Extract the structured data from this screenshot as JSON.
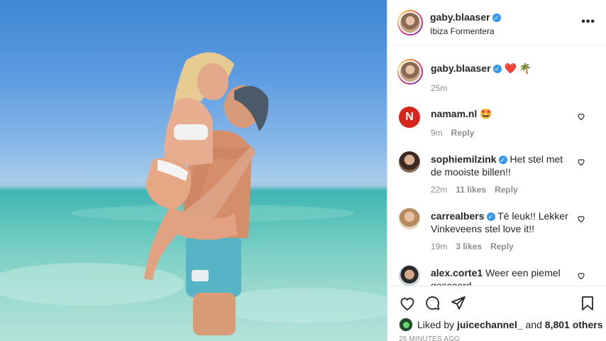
{
  "post": {
    "author": "gaby.blaaser",
    "location": "Ibiza Formentera",
    "more_label": "•••"
  },
  "caption": {
    "username": "gaby.blaaser",
    "text": "❤️ 🌴",
    "time": "25m"
  },
  "comments": [
    {
      "username": "namam.nl",
      "text": "🤩",
      "time": "9m",
      "likes": "",
      "reply": "Reply",
      "avatar_letter": "N"
    },
    {
      "username": "sophiemilzink",
      "text": "Het stel met de mooiste billen!!",
      "time": "22m",
      "likes": "11 likes",
      "reply": "Reply"
    },
    {
      "username": "carrealbers",
      "text": "Té leuk!! Lekker Vinkeveens stel love it!!",
      "time": "19m",
      "likes": "3 likes",
      "reply": "Reply"
    },
    {
      "username": "alex.corte1",
      "text": "Weer een piemel gescoord",
      "time": "",
      "likes": "",
      "reply": ""
    }
  ],
  "likes": {
    "prefix": "Liked by",
    "user": "juicechannel_",
    "middle": "and",
    "count": "8,801 others"
  },
  "timestamp": "25 MINUTES AGO",
  "colors": {
    "verified": "#3897f0",
    "muted": "#8e8e8e",
    "text": "#262626"
  }
}
